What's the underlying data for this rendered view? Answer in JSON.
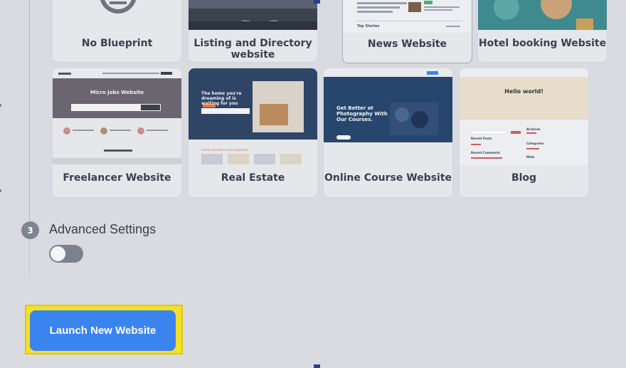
{
  "blueprints": {
    "row1": [
      {
        "key": "nobp",
        "label": "No Blueprint"
      },
      {
        "key": "listing",
        "label": "Listing and Directory website"
      },
      {
        "key": "news",
        "label": "News Website",
        "thumb_text": [
          "Top Stories"
        ]
      },
      {
        "key": "hotel",
        "label": "Hotel booking Website"
      }
    ],
    "row2": [
      {
        "key": "freelancer",
        "label": "Freelancer Website",
        "thumb_title": "Micro Jobs Website"
      },
      {
        "key": "realestate",
        "label": "Real Estate",
        "thumb_title": "The home you're dreaming of is waiting for you",
        "thumb_sub": "Latest selection of our properties"
      },
      {
        "key": "course",
        "label": "Online Course Website",
        "thumb_title": "Get Better at Photography With Our Courses."
      },
      {
        "key": "blog",
        "label": "Blog",
        "thumb_title": "Hello world!",
        "thumb_side": [
          "Archives",
          "Categories",
          "Meta"
        ],
        "thumb_main": [
          "Recent Posts",
          "Recent Comments"
        ]
      }
    ]
  },
  "advanced": {
    "step": "3",
    "title": "Advanced Settings",
    "toggle_on": false
  },
  "launch": {
    "label": "Launch New Website"
  },
  "colors": {
    "accent": "#3a84f0",
    "highlight": "#f2e02a",
    "background": "#d9dbe0"
  }
}
